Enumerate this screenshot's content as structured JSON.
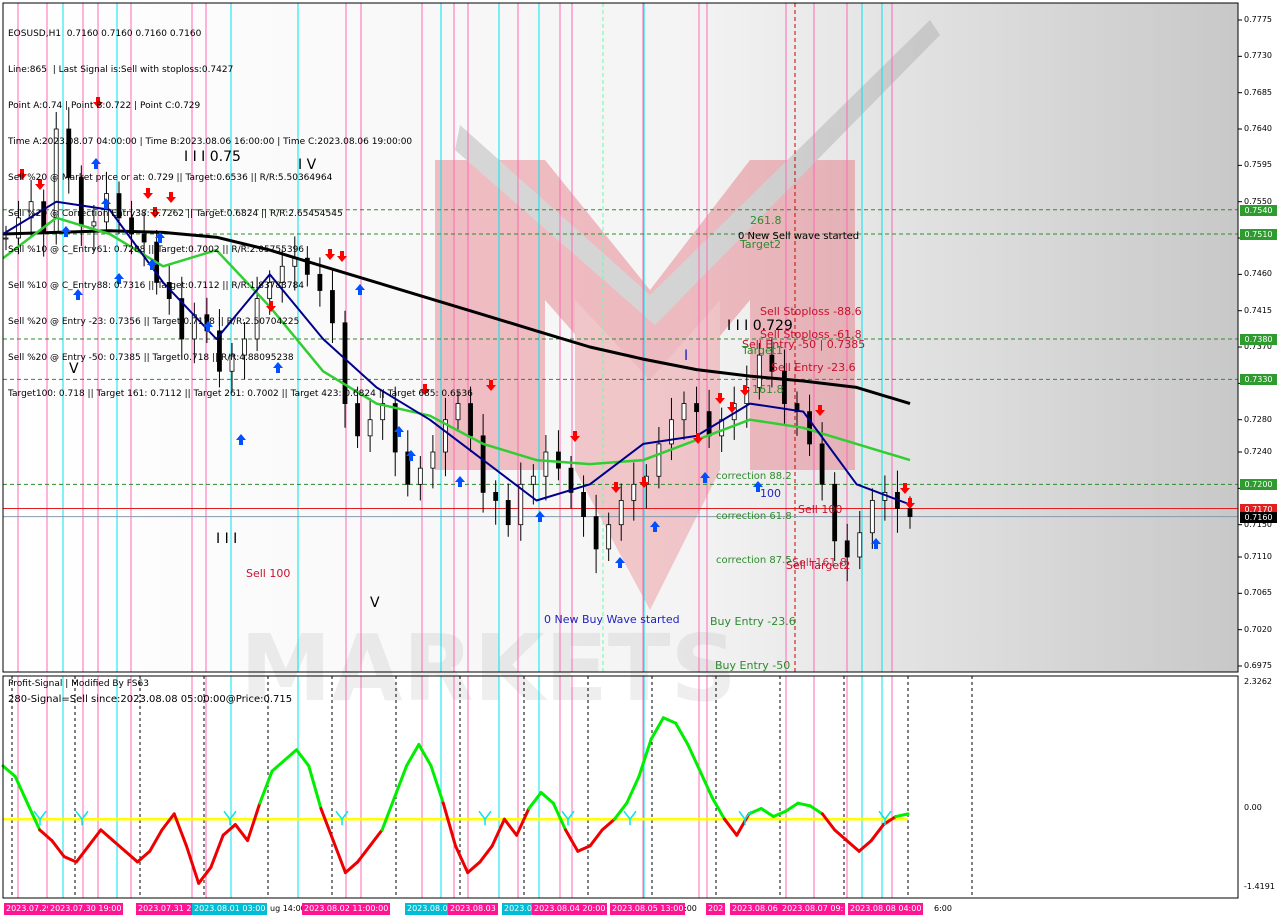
{
  "header": {
    "symbol_line": "EOSUSD,H1  0.7160 0.7160 0.7160 0.7160",
    "lines": [
      "Line:865  | Last Signal is:Sell with stoploss:0.7427",
      "Point A:0.74 | Point B:0.722 | Point C:0.729",
      "Time A:2023.08.07 04:00:00 | Time B:2023.08.06 16:00:00 | Time C:2023.08.06 19:00:00",
      "Sell %20 @ Market price or at: 0.729 || Target:0.6536 || R/R:5.50364964",
      "Sell %20 @ Correction Entry38: 0.7262 || Target:0.6824 || R/R:2.65454545",
      "Sell %10 @ C_Entry61: 0.7288 || Target:0.7002 || R/R:2.05755396",
      "Sell %10 @ C_Entry88: 0.7316 || Target:0.7112 || R/R:1.83783784",
      "Sell %20 @ Entry -23: 0.7356 || Target:0.7178 || R/R:2.50704225",
      "Sell %20 @ Entry -50: 0.7385 || Target:0.718 || R/R:4.88095238",
      "Target100: 0.718 || Target 161: 0.7112 || Target 261: 0.7002 || Target 423: 0.6824 || Target 685: 0.6536"
    ]
  },
  "indicator": {
    "title": "Profit-Signal | Modified By FS63",
    "signal": "280-Signal=Sell since:2023.08.08 05:00:00@Price:0.715"
  },
  "annotations": {
    "wave_iii_075": "I I I 0.75",
    "wave_iv_top": "I V",
    "wave_v_left": "V",
    "wave_iii_bottom": "I I I",
    "wave_v_bottom": "V",
    "sell100_left": "Sell 100",
    "new_buy_wave": "0 New Buy Wave started",
    "fib_261": "261.8",
    "new_sell_wave": "0 New Sell wave started",
    "target2": "Target2",
    "sell_stoploss_886": "Sell Stoploss -88.6",
    "iii_0729": "I I I 0.729",
    "sell_stoploss_618": "Sell Stoploss -61.8",
    "sell_entry_50": "Sell Entry -50 | 0.7385",
    "target1": "Target1",
    "wave_i": "I",
    "sell_entry_236": "Sell Entry -23.6",
    "fib_1618": "161.8",
    "correction_882": "correction 88.2",
    "fib_100": "100",
    "correction_618": "correction 61.8",
    "sell_100_right": "Sell 100",
    "correction_875": "correction 87.5",
    "sell_target2": "Sell Target2",
    "sell_1618": "Sell 161.8",
    "buy_entry_236": "Buy Entry -23.6",
    "buy_entry_50": "Buy Entry -50"
  },
  "price_axis": {
    "ticks": [
      "0.7775",
      "0.7730",
      "0.7685",
      "0.7640",
      "0.7595",
      "0.7550",
      "0.7505",
      "0.7460",
      "0.7415",
      "0.7370",
      "0.7325",
      "0.7280",
      "0.7240",
      "0.7195",
      "0.7150",
      "0.7110",
      "0.7065",
      "0.7020",
      "0.6975"
    ],
    "boxes": [
      {
        "value": "0.7540",
        "color": "#2e9b2e"
      },
      {
        "value": "0.7510",
        "color": "#2e9b2e"
      },
      {
        "value": "0.7380",
        "color": "#2e9b2e"
      },
      {
        "value": "0.7330",
        "color": "#2e9b2e"
      },
      {
        "value": "0.7200",
        "color": "#2e9b2e"
      },
      {
        "value": "0.7170",
        "color": "#e02020"
      },
      {
        "value": "0.7160",
        "color": "#000000"
      }
    ]
  },
  "indicator_axis": {
    "ticks": [
      "2.3262",
      "0.00",
      "-1.4191"
    ]
  },
  "time_axis": {
    "labels": [
      {
        "text": "2023.07.29",
        "color": "#ff1493"
      },
      {
        "text": "2023.07.30 19:00",
        "color": "#ff1493"
      },
      {
        "text": "2023.07.31 22:",
        "color": "#ff1493"
      },
      {
        "text": "2023.08.01 03:00",
        "color": "#00bcd4"
      },
      {
        "text": "ug 14:00",
        "color": "none"
      },
      {
        "text": "2023.08.02 11:00:00",
        "color": "#ff1493"
      },
      {
        "text": "2023.08.0",
        "color": "#00bcd4"
      },
      {
        "text": "2023.08.03",
        "color": "#ff1493"
      },
      {
        "text": "2023.0",
        "color": "#00bcd4"
      },
      {
        "text": "2023.08.04 20:00",
        "color": "#ff1493"
      },
      {
        "text": "2023.08.05 13:00",
        "color": "#ff1493"
      },
      {
        "text": ":00",
        "color": "none"
      },
      {
        "text": "202",
        "color": "#ff1493"
      },
      {
        "text": "2023.08.06",
        "color": "#ff1493"
      },
      {
        "text": "2023.08.07 09:",
        "color": "#ff1493"
      },
      {
        "text": "2023.08.08 04:00",
        "color": "#ff1493"
      },
      {
        "text": "6:00",
        "color": "none"
      }
    ]
  },
  "watermark": {
    "text": "MARKETS"
  },
  "colors": {
    "bull_candle": "#000000",
    "bear_candle": "#000000",
    "ema_fast": "#00008b",
    "ema_mid": "#32cd32",
    "ema_slow": "#000000",
    "signal_green": "#00ee00",
    "signal_red": "#ee0000",
    "zero_line": "#ffff00",
    "vline_pink": "#ff69b4",
    "vline_cyan": "#00e5ee",
    "arrow_buy": "#0050ff",
    "arrow_sell": "#ff0000"
  },
  "chart_data": {
    "type": "candlestick",
    "symbol": "EOSUSD",
    "timeframe": "H1",
    "ylim": [
      0.6975,
      0.7775
    ],
    "x_range": [
      "2023.07.29",
      "2023.08.08"
    ],
    "close_series": [
      0.7505,
      0.753,
      0.755,
      0.7512,
      0.764,
      0.758,
      0.752,
      0.7525,
      0.756,
      0.753,
      0.751,
      0.75,
      0.745,
      0.743,
      0.738,
      0.741,
      0.739,
      0.734,
      0.736,
      0.738,
      0.743,
      0.745,
      0.747,
      0.748,
      0.746,
      0.744,
      0.74,
      0.73,
      0.726,
      0.728,
      0.73,
      0.724,
      0.72,
      0.722,
      0.724,
      0.728,
      0.73,
      0.726,
      0.719,
      0.718,
      0.715,
      0.72,
      0.721,
      0.724,
      0.722,
      0.719,
      0.716,
      0.712,
      0.715,
      0.718,
      0.72,
      0.721,
      0.725,
      0.728,
      0.73,
      0.729,
      0.726,
      0.728,
      0.73,
      0.732,
      0.736,
      0.734,
      0.73,
      0.729,
      0.725,
      0.72,
      0.713,
      0.711,
      0.714,
      0.718,
      0.719,
      0.717,
      0.716
    ],
    "ema_slow": [
      0.751,
      0.7512,
      0.7514,
      0.7512,
      0.7506,
      0.749,
      0.747,
      0.745,
      0.743,
      0.741,
      0.739,
      0.737,
      0.7355,
      0.7342,
      0.7334,
      0.7328,
      0.732,
      0.73
    ],
    "ema_mid": [
      0.748,
      0.753,
      0.751,
      0.747,
      0.749,
      0.742,
      0.734,
      0.73,
      0.7285,
      0.725,
      0.723,
      0.7225,
      0.723,
      0.7255,
      0.728,
      0.727,
      0.725,
      0.723
    ],
    "ema_fast": [
      0.751,
      0.755,
      0.754,
      0.745,
      0.738,
      0.746,
      0.738,
      0.732,
      0.728,
      0.723,
      0.718,
      0.72,
      0.725,
      0.726,
      0.73,
      0.729,
      0.72,
      0.7175
    ],
    "levels": [
      {
        "price": 0.754,
        "style": "dashed-green"
      },
      {
        "price": 0.751,
        "style": "dashed-green"
      },
      {
        "price": 0.738,
        "style": "dashed-green"
      },
      {
        "price": 0.733,
        "style": "dashed-green"
      },
      {
        "price": 0.72,
        "style": "dashed-green"
      },
      {
        "price": 0.717,
        "style": "solid-red"
      },
      {
        "price": 0.716,
        "style": "current"
      }
    ],
    "indicator": {
      "ylim": [
        -1.4191,
        2.3262
      ],
      "zero": 0.0,
      "values": [
        1.0,
        0.8,
        0.3,
        -0.2,
        -0.4,
        -0.7,
        -0.8,
        -0.5,
        -0.2,
        -0.4,
        -0.6,
        -0.8,
        -0.6,
        -0.2,
        0.1,
        -0.5,
        -1.2,
        -0.9,
        -0.3,
        -0.1,
        -0.4,
        0.3,
        0.9,
        1.1,
        1.3,
        1.0,
        0.2,
        -0.4,
        -1.0,
        -0.8,
        -0.5,
        -0.2,
        0.4,
        1.0,
        1.4,
        1.0,
        0.3,
        -0.5,
        -1.0,
        -0.8,
        -0.5,
        0.0,
        -0.3,
        0.2,
        0.5,
        0.3,
        -0.2,
        -0.6,
        -0.5,
        -0.2,
        0.0,
        0.3,
        0.8,
        1.5,
        1.9,
        1.8,
        1.4,
        0.9,
        0.4,
        0.0,
        -0.3,
        0.1,
        0.2,
        0.05,
        0.15,
        0.3,
        0.25,
        0.1,
        -0.2,
        -0.4,
        -0.6,
        -0.4,
        -0.1,
        0.05,
        0.1
      ]
    }
  }
}
